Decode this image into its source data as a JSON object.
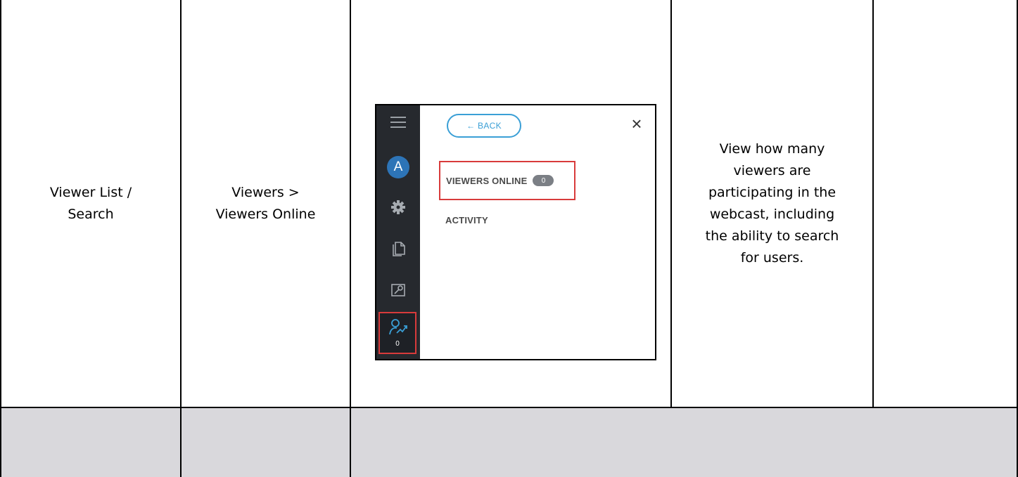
{
  "table": {
    "row": {
      "feature": [
        "Viewer List /",
        "Search"
      ],
      "location": [
        "Viewers >",
        "Viewers Online"
      ],
      "description": [
        "View how many",
        "viewers are",
        "participating in the",
        "webcast, including",
        "the ability to search",
        "for users."
      ]
    }
  },
  "screenshot": {
    "rail": {
      "icons": [
        "hamburger-icon",
        "avatar",
        "gear-icon",
        "documents-icon",
        "tools-icon",
        "viewers-icon"
      ],
      "avatar_letter": "A",
      "viewers_count": "0"
    },
    "back_label": "← BACK",
    "close_glyph": "×",
    "viewers_online_label": "VIEWERS ONLINE",
    "viewers_online_count": "0",
    "activity_label": "ACTIVITY",
    "colors": {
      "rail": "#26292e",
      "accent": "#3a9fd6",
      "avatar": "#2d74b7",
      "highlight": "#d83b3b"
    }
  },
  "colors": {
    "gray_row": "#d9d8dc",
    "border": "#000000"
  }
}
